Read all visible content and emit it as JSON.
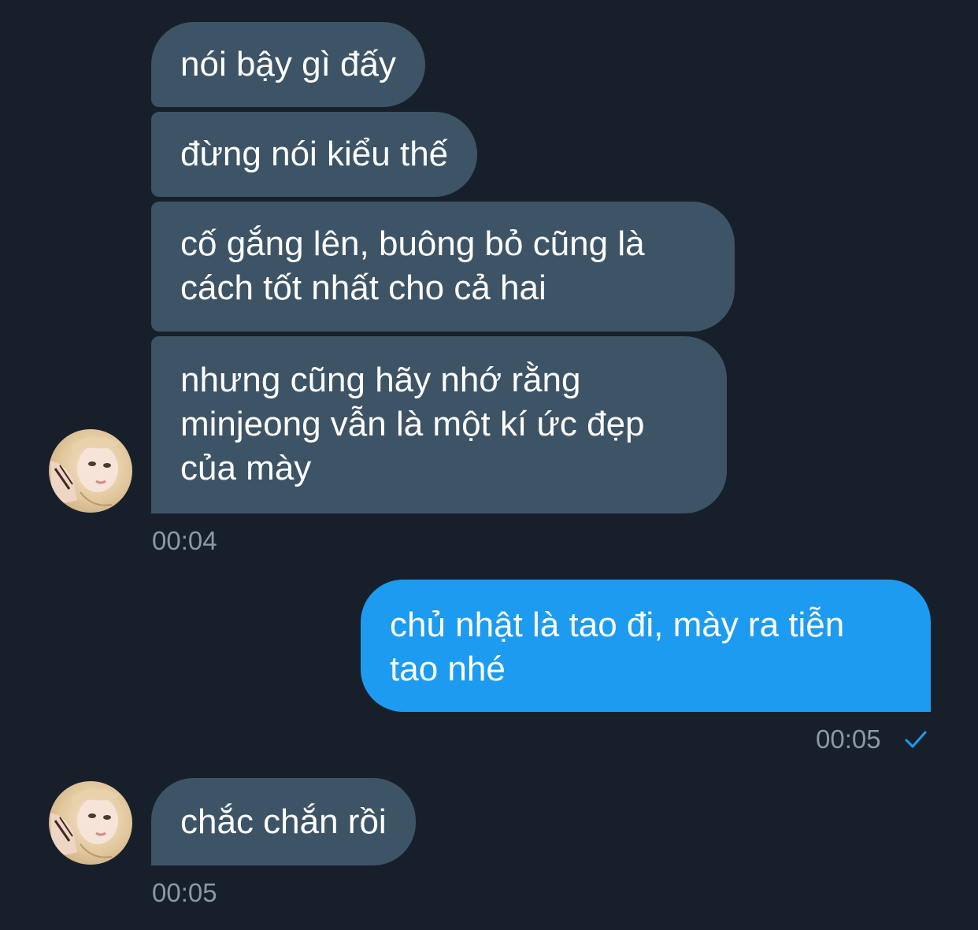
{
  "conversation": {
    "incoming_group_1": {
      "messages": [
        {
          "lines": [
            "nói bậy gì đấy"
          ]
        },
        {
          "lines": [
            "đừng nói kiểu thế"
          ]
        },
        {
          "lines": [
            "cố gắng lên, buông bỏ cũng là",
            "cách tốt nhất cho cả hai"
          ]
        },
        {
          "lines": [
            "nhưng cũng hãy nhớ rằng",
            "minjeong vẫn là một kí ức đẹp",
            "của mày"
          ]
        }
      ],
      "timestamp": "00:04",
      "avatar_icon": "user-avatar"
    },
    "outgoing_group_1": {
      "messages": [
        {
          "lines": [
            "chủ nhật là tao đi, mày ra tiễn",
            "tao nhé"
          ]
        }
      ],
      "timestamp": "00:05",
      "status_icon": "checkmark-icon"
    },
    "incoming_group_2": {
      "messages": [
        {
          "lines": [
            "chắc chắn rồi"
          ]
        }
      ],
      "timestamp": "00:05",
      "avatar_icon": "user-avatar"
    }
  },
  "colors": {
    "background": "#17202a",
    "incoming_bubble": "#3d5466",
    "outgoing_bubble": "#1d9bf0",
    "timestamp": "#8b98a5",
    "read_check": "#1d9bf0"
  }
}
